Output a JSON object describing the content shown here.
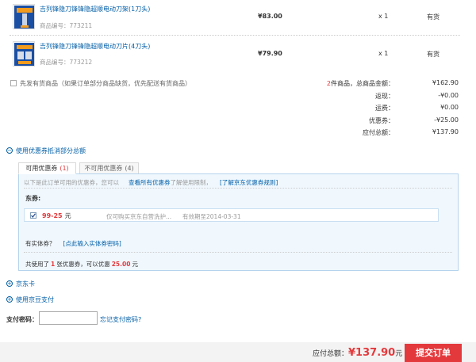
{
  "products": [
    {
      "name": "吉列锋隐刀锋锋隐超顺电动刀架(1刀头)",
      "sku_label": "商品编号：773211",
      "price": "¥83.00",
      "qty": "x 1",
      "stock": "有货"
    },
    {
      "name": "吉列锋隐刀锋锋隐超顺电动刀片(4刀头)",
      "sku_label": "商品编号：773212",
      "price": "¥79.90",
      "qty": "x 1",
      "stock": "有货"
    }
  ],
  "ship_option": {
    "label": "先发有货商品（如果订单部分商品缺货，优先配送有货商品）"
  },
  "summary": {
    "count": "2",
    "count_suffix": "件商品，总商品金额：",
    "total": "¥162.90",
    "rows": [
      {
        "label": "返现：",
        "value": "-¥0.00"
      },
      {
        "label": "运费：",
        "value": "¥0.00"
      },
      {
        "label": "优惠券：",
        "value": "-¥25.00"
      },
      {
        "label": "应付总额：",
        "value": "¥137.90"
      }
    ]
  },
  "coupon_section": {
    "toggle_label": "使用优惠券抵消部分总额",
    "tabs": {
      "available": "可用优惠券",
      "available_count": "(1)",
      "unavailable": "不可用优惠券",
      "unavailable_count": "(4)"
    },
    "info_prefix": "以下是此订单可用的优惠券，您可以",
    "info_link1": "查看所有优惠券",
    "info_mid": "了解使用限制，",
    "info_link2": "[了解京东优惠券规则]",
    "group_title": "东券:",
    "coupon": {
      "amount": "99-25",
      "unit": "元",
      "desc": "仅可购买京东自营洗护...",
      "expiry": "有效期至2014-03-31"
    },
    "physical_label": "有实体券？",
    "physical_link": "[点此输入实体券密码]",
    "used_prefix": "共使用了",
    "used_count": "1",
    "used_mid": "张优惠券，可以优惠",
    "discount": "25.00",
    "discount_unit": "元"
  },
  "jd_card": {
    "label": "京东卡"
  },
  "jd_bean": {
    "label": "使用京豆支付"
  },
  "pay_password": {
    "label": "支付密码：",
    "value": "",
    "forgot": "忘记支付密码?"
  },
  "footer": {
    "total_label": "应付总额：",
    "total_value": "¥137.90",
    "total_unit": "元",
    "submit_label": "提交订单"
  },
  "colors": {
    "accent_red": "#e4393c",
    "link_blue": "#005ea7",
    "panel_bg": "#f0f8fe",
    "panel_border": "#b5d3ec"
  }
}
